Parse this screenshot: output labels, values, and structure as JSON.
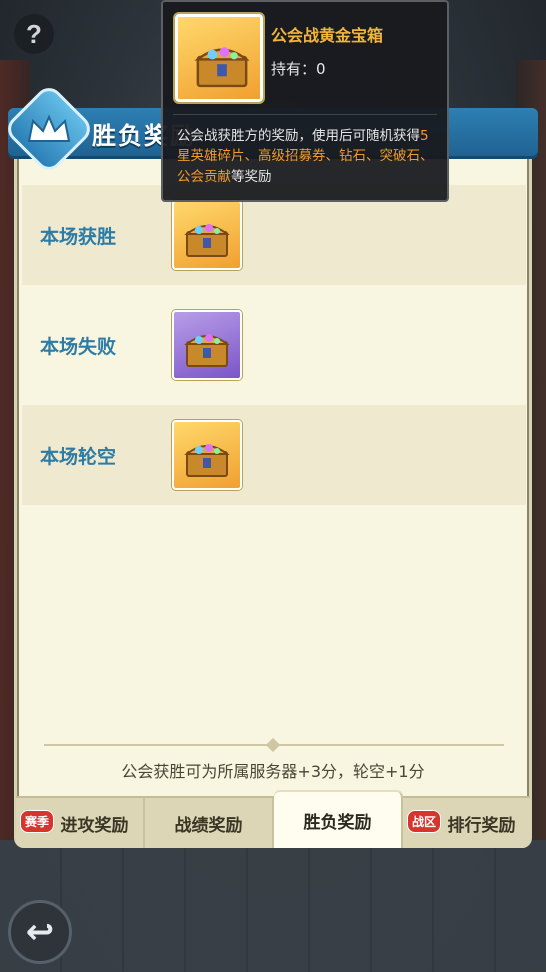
{
  "help": {
    "label": "?"
  },
  "header": {
    "title": "胜负奖励"
  },
  "rows": [
    {
      "label": "本场获胜",
      "reward": "gold-chest"
    },
    {
      "label": "本场失败",
      "reward": "purple-chest"
    },
    {
      "label": "本场轮空",
      "reward": "gold-chest"
    }
  ],
  "footer_note": "公会获胜可为所属服务器+3分，轮空+1分",
  "tabs": [
    {
      "label": "进攻奖励",
      "badge": "赛季"
    },
    {
      "label": "战绩奖励"
    },
    {
      "label": "胜负奖励",
      "active": true
    },
    {
      "label": "排行奖励",
      "badge": "战区"
    }
  ],
  "back": {
    "label": "↩"
  },
  "tooltip": {
    "name": "公会战黄金宝箱",
    "owned": "持有：0",
    "desc_part1": "公会战获胜方的奖励，使用后可随机获得",
    "desc_highlight": "5星英雄碎片、高级招募券、钻石、突破石、公会贡献",
    "desc_part2": "等奖励"
  },
  "colors": {
    "accent_blue": "#2d7ca6",
    "tooltip_title": "#f2b53a",
    "highlight": "#f29a2a",
    "badge_red": "#d6342c"
  }
}
